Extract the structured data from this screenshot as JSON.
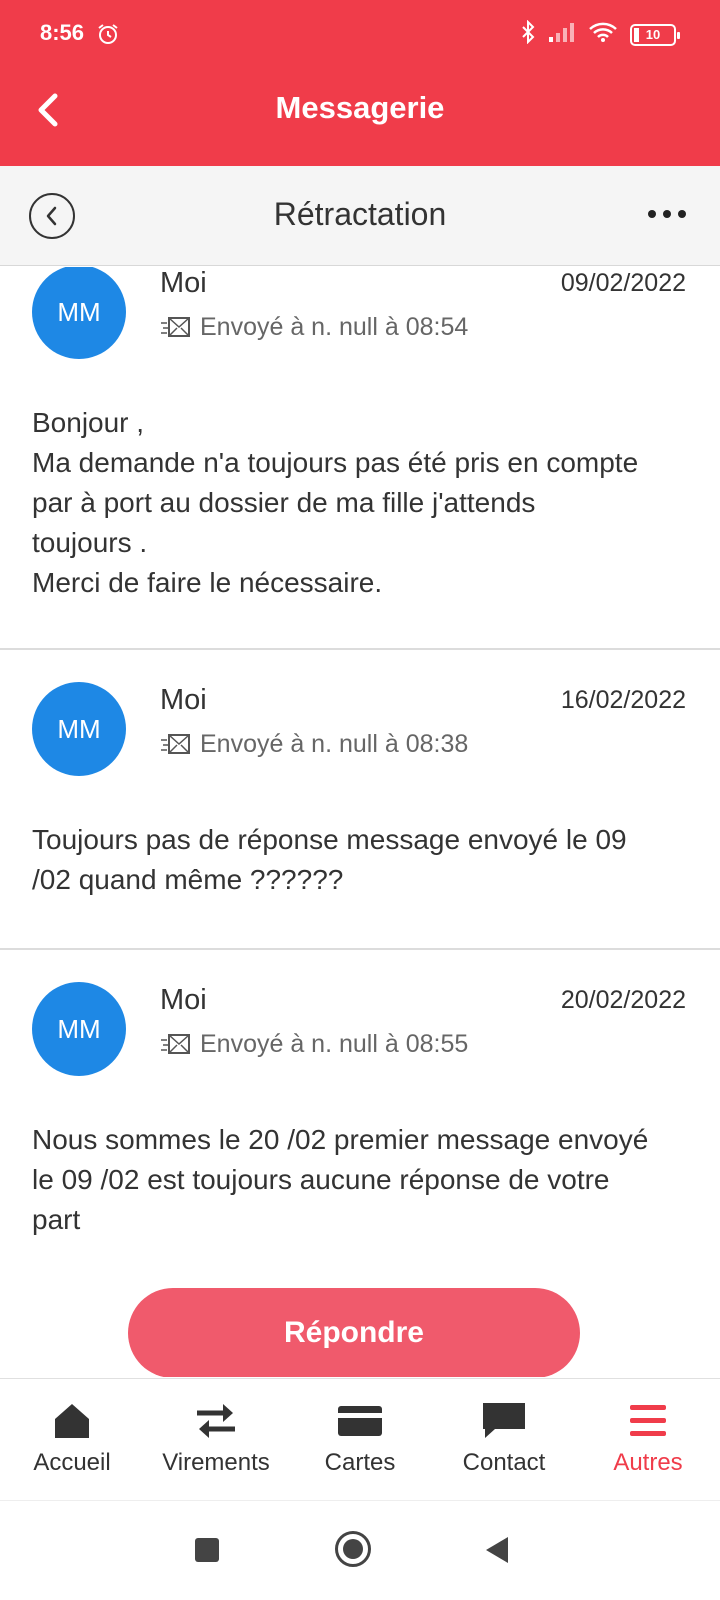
{
  "status_bar": {
    "time": "8:56",
    "battery": "10"
  },
  "header": {
    "title": "Messagerie"
  },
  "subheader": {
    "title": "Rétractation"
  },
  "messages": [
    {
      "initials": "MM",
      "sender": "Moi",
      "date": "09/02/2022",
      "sent": "Envoyé à n. null à 08:54",
      "body_lines": [
        "Bonjour ,",
        "Ma demande n'a toujours pas été pris en compte",
        "par à port au dossier de ma fille j'attends",
        "toujours .",
        "Merci de faire le nécessaire."
      ]
    },
    {
      "initials": "MM",
      "sender": "Moi",
      "date": "16/02/2022",
      "sent": "Envoyé à n. null à 08:38",
      "body_lines": [
        "Toujours pas de réponse message envoyé le 09",
        "/02 quand même ??????"
      ]
    },
    {
      "initials": "MM",
      "sender": "Moi",
      "date": "20/02/2022",
      "sent": "Envoyé à n. null à 08:55",
      "body_lines": [
        "Nous sommes le 20 /02 premier message envoyé",
        "le 09 /02 est toujours aucune réponse de votre",
        "part"
      ]
    }
  ],
  "reply_button": "Répondre",
  "bottom_nav": [
    {
      "label": "Accueil",
      "icon": "home-icon"
    },
    {
      "label": "Virements",
      "icon": "transfer-icon"
    },
    {
      "label": "Cartes",
      "icon": "card-icon"
    },
    {
      "label": "Contact",
      "icon": "chat-icon"
    },
    {
      "label": "Autres",
      "icon": "menu-icon"
    }
  ],
  "colors": {
    "brand": "#f03c4a",
    "avatar": "#1e88e5",
    "reply": "#f05a6c"
  }
}
